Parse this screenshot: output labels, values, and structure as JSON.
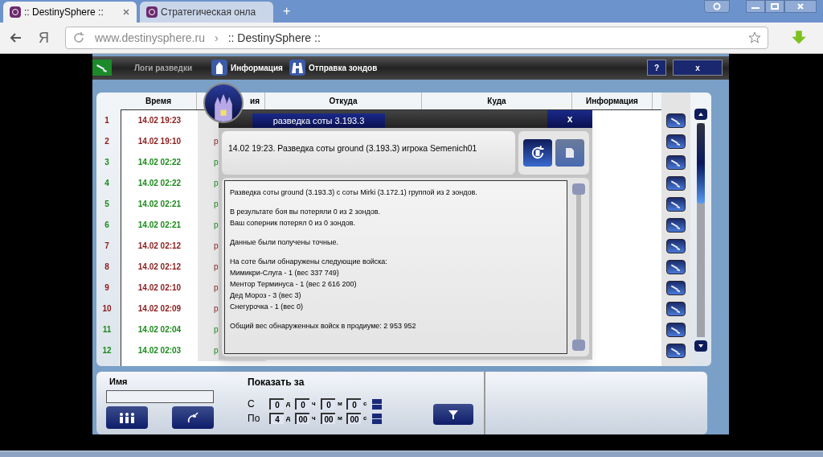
{
  "browser": {
    "tabs": [
      {
        "label": ":: DestinySphere ::",
        "selected": true
      },
      {
        "label": "Стратегическая онла",
        "selected": false
      }
    ],
    "new_tab": "+",
    "yandex": "Я",
    "url": "www.destinysphere.ru",
    "url_separator": "›",
    "page_title": ":: DestinySphere ::"
  },
  "game_bar": {
    "tabs": [
      {
        "label": "Логи разведки",
        "selected": false,
        "kind": "telescope"
      },
      {
        "label": "Информация",
        "selected": true,
        "kind": "house"
      },
      {
        "label": "Отправка зондов",
        "selected": true,
        "kind": "binoculars"
      }
    ],
    "help": "?",
    "close": "x"
  },
  "table": {
    "columns": [
      "Время",
      "ия",
      "Откуда",
      "Куда",
      "Информация"
    ],
    "rows": [
      {
        "num": "1",
        "time": "14.02 19:23",
        "column_3": "",
        "color": "#8b1a1a"
      },
      {
        "num": "2",
        "time": "14.02 19:10",
        "column_3": "р",
        "color": "#8b1a1a"
      },
      {
        "num": "3",
        "time": "14.02 02:22",
        "column_3": "р",
        "color": "#1a8a1a"
      },
      {
        "num": "4",
        "time": "14.02 02:22",
        "column_3": "р",
        "color": "#1a8a1a"
      },
      {
        "num": "5",
        "time": "14.02 02:21",
        "column_3": "р",
        "color": "#1a8a1a"
      },
      {
        "num": "6",
        "time": "14.02 02:21",
        "column_3": "р",
        "color": "#1a8a1a"
      },
      {
        "num": "7",
        "time": "14.02 02:12",
        "column_3": "р",
        "color": "#8b1a1a"
      },
      {
        "num": "8",
        "time": "14.02 02:12",
        "column_3": "р",
        "color": "#8b1a1a"
      },
      {
        "num": "9",
        "time": "14.02 02:10",
        "column_3": "р",
        "color": "#8b1a1a"
      },
      {
        "num": "10",
        "time": "14.02 02:09",
        "column_3": "р",
        "color": "#8b1a1a"
      },
      {
        "num": "11",
        "time": "14.02 02:04",
        "column_3": "р",
        "color": "#1a8a1a"
      },
      {
        "num": "12",
        "time": "14.02 02:03",
        "column_3": "р",
        "color": "#1a8a1a"
      }
    ]
  },
  "report": {
    "title": "разведка соты 3.193.3",
    "close": "x",
    "header": "14.02 19:23. Разведка соты ground (3.193.3) игрока Semenich01",
    "paragraphs": [
      [
        "Разведка соты ground (3.193.3) с соты Mirki (3.172.1) группой из 2 зондов."
      ],
      [
        "В результате боя вы потеряли 0 из 2 зондов.",
        "Ваш соперник потерял 0 из 0 зондов."
      ],
      [
        "Данные были получены точные."
      ],
      [
        "На соте были обнаружены следующие войска:",
        "Мимикри-Слуга - 1 (вес 337 749)",
        "Ментор Терминуса - 1 (вес 2 616 200)",
        "Дед Мороз - 3 (вес 3)",
        "Снегурочка - 1 (вес 0)"
      ],
      [
        "Общий вес обнаруженных войск в продиуме: 2 953 952"
      ]
    ]
  },
  "filter": {
    "name_label": "Имя",
    "period_label": "Показать за",
    "ranges": [
      {
        "label": "С",
        "fields": [
          {
            "value": "0",
            "unit": "д"
          },
          {
            "value": "0",
            "unit": "ч"
          },
          {
            "value": "0",
            "unit": "м"
          },
          {
            "value": "0",
            "unit": "с"
          }
        ]
      },
      {
        "label": "По",
        "fields": [
          {
            "value": "4",
            "unit": "д"
          },
          {
            "value": "00",
            "unit": "ч"
          },
          {
            "value": "00",
            "unit": "м"
          },
          {
            "value": "00",
            "unit": "с"
          }
        ]
      }
    ]
  }
}
